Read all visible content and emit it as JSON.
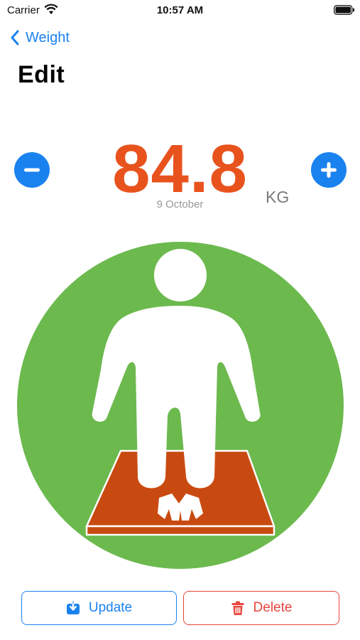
{
  "status_bar": {
    "carrier": "Carrier",
    "time": "10:57 AM",
    "icons": [
      "wifi-icon",
      "battery-icon"
    ]
  },
  "nav": {
    "back_label": "Weight",
    "title": "Edit"
  },
  "weight": {
    "value": "84.8",
    "unit": "KG",
    "date": "9 October",
    "decrement_icon": "minus-icon",
    "increment_icon": "plus-icon"
  },
  "illustration": {
    "icon": "person-on-scale-icon"
  },
  "actions": {
    "update_label": "Update",
    "update_icon": "download-icon",
    "delete_label": "Delete",
    "delete_icon": "trash-icon"
  },
  "colors": {
    "accent": "#1a82ef",
    "weight": "#e8531d",
    "circle": "#6cb94e",
    "scale": "#c94a10",
    "danger": "#e8453c"
  }
}
